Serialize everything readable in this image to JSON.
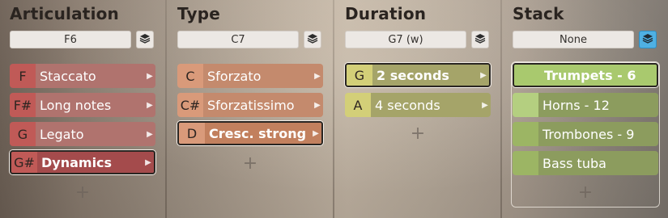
{
  "colors": {
    "articulation_key": "#c05a57",
    "articulation_label": "#b0736e",
    "articulation_selected_label": "#a44b4c",
    "type_key": "#d99a7a",
    "type_label": "#c48a6d",
    "type_selected_label": "#c2805e",
    "duration_key": "#d3cf78",
    "duration_label": "#a5a469",
    "stack_key": "#a9c96e",
    "stack_label": "#8c9c5e",
    "stack_active_button": "#4fb0e3"
  },
  "columns": [
    {
      "heading": "Articulation",
      "selector_value": "F6",
      "stack_icon": "layers-icon",
      "rows": [
        {
          "key": "F",
          "label": "Staccato",
          "selected": false
        },
        {
          "key": "F#",
          "label": "Long notes",
          "selected": false
        },
        {
          "key": "G",
          "label": "Legato",
          "selected": false
        },
        {
          "key": "G#",
          "label": "Dynamics",
          "selected": true
        }
      ],
      "add_label": "+"
    },
    {
      "heading": "Type",
      "selector_value": "C7",
      "stack_icon": "layers-icon",
      "rows": [
        {
          "key": "C",
          "label": "Sforzato",
          "selected": false
        },
        {
          "key": "C#",
          "label": "Sforzatissimo",
          "selected": false
        },
        {
          "key": "D",
          "label": "Cresc. strong",
          "selected": true
        }
      ],
      "add_label": "+"
    },
    {
      "heading": "Duration",
      "selector_value": "G7 (w)",
      "stack_icon": "layers-icon",
      "rows": [
        {
          "key": "G",
          "label": "2 seconds",
          "selected": true
        },
        {
          "key": "A",
          "label": "4 seconds",
          "selected": false
        }
      ],
      "add_label": "+"
    },
    {
      "heading": "Stack",
      "selector_value": "None",
      "stack_icon": "layers-icon",
      "stack_active": true,
      "rows": [
        {
          "key": "",
          "label": "Trumpets - 6",
          "selected": true
        },
        {
          "key": "",
          "label": "Horns - 12",
          "selected": false
        },
        {
          "key": "",
          "label": "Trombones - 9",
          "selected": false
        },
        {
          "key": "",
          "label": "Bass tuba",
          "selected": false
        }
      ],
      "add_label": "+"
    }
  ]
}
